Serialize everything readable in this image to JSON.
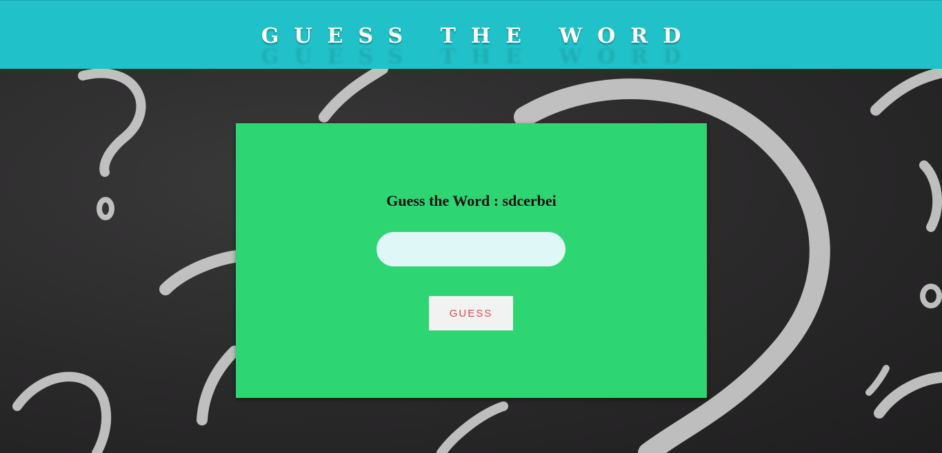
{
  "header": {
    "title": "GUESS THE WORD"
  },
  "game": {
    "prompt_label": "Guess the Word : sdcerbei",
    "input_value": "",
    "input_placeholder": "",
    "button_label": "GUESS"
  },
  "colors": {
    "header_bg": "#21c1c9",
    "card_bg": "#2ed573",
    "input_bg": "#e0f7f8",
    "button_bg": "#f2f2f2",
    "button_text": "#e04848",
    "background": "#2b2a2b"
  }
}
